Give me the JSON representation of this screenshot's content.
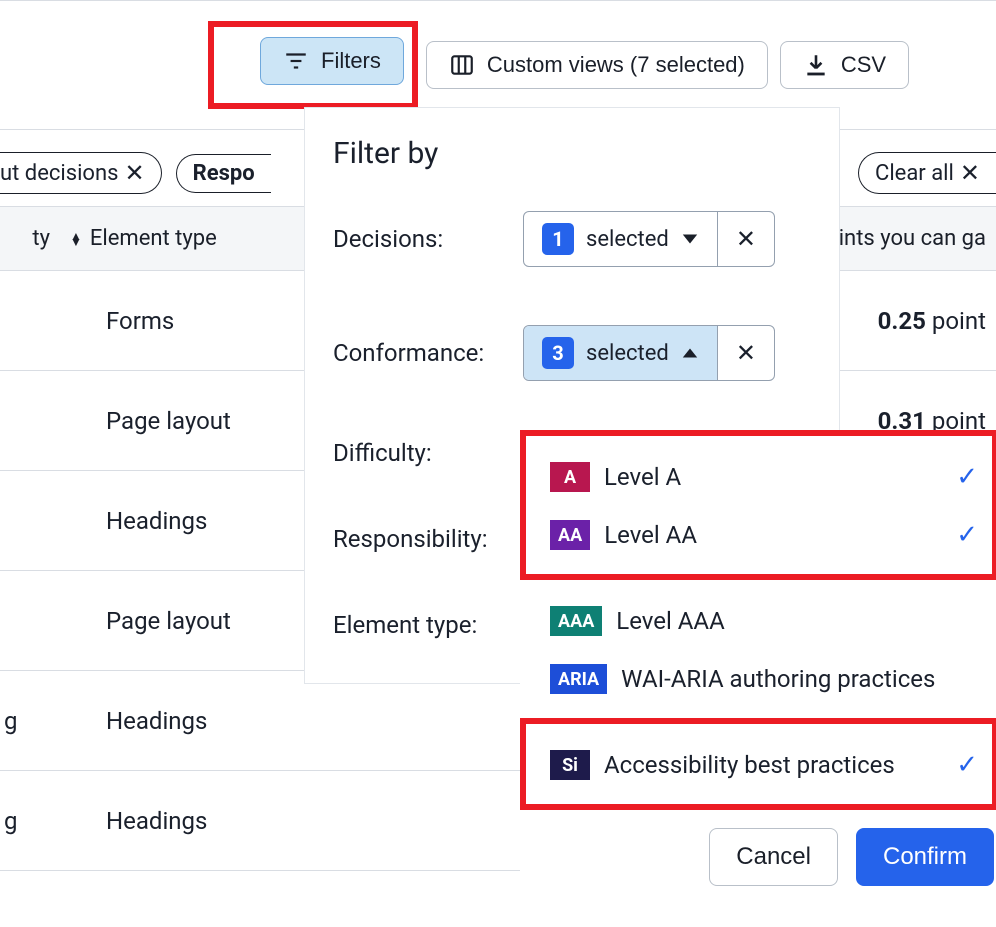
{
  "toolbar": {
    "filters_label": "Filters",
    "custom_views_label": "Custom views (7 selected)",
    "csv_label": "CSV"
  },
  "pills": {
    "decisions_fragment": "ut decisions",
    "responsibility_fragment": "Respo",
    "clear_all_label": "Clear all"
  },
  "table": {
    "severity_header": "ty",
    "element_type_header": "Element type",
    "points_header": "pints you can ga",
    "rows": [
      {
        "element": "Forms",
        "points": "0.25",
        "unit": "point"
      },
      {
        "element": "Page layout",
        "points": "0.31",
        "unit": "point"
      },
      {
        "element": "Headings",
        "points": "",
        "unit": ""
      },
      {
        "element": "Page layout",
        "points": "",
        "unit": ""
      },
      {
        "element": "Headings",
        "points": "",
        "unit": "",
        "prefix": "g"
      },
      {
        "element": "Headings",
        "points": "",
        "unit": "",
        "prefix": "g"
      }
    ]
  },
  "filter_panel": {
    "title": "Filter by",
    "rows": {
      "decisions": {
        "label": "Decisions:",
        "count": "1",
        "selected_text": "selected"
      },
      "conformance": {
        "label": "Conformance:",
        "count": "3",
        "selected_text": "selected"
      },
      "difficulty": {
        "label": "Difficulty:"
      },
      "responsibility": {
        "label": "Responsibility:"
      },
      "element_type": {
        "label": "Element type:"
      }
    },
    "conformance_options": [
      {
        "badge": "A",
        "label": "Level A",
        "cls": "lvl-a",
        "checked": true
      },
      {
        "badge": "AA",
        "label": "Level AA",
        "cls": "lvl-aa",
        "checked": true
      },
      {
        "badge": "AAA",
        "label": "Level AAA",
        "cls": "lvl-aaa",
        "checked": false
      },
      {
        "badge": "ARIA",
        "label": "WAI-ARIA authoring practices",
        "cls": "lvl-aria",
        "checked": false
      },
      {
        "badge": "Si",
        "label": "Accessibility best practices",
        "cls": "lvl-si",
        "checked": true
      }
    ],
    "actions": {
      "cancel": "Cancel",
      "confirm": "Confirm"
    }
  }
}
